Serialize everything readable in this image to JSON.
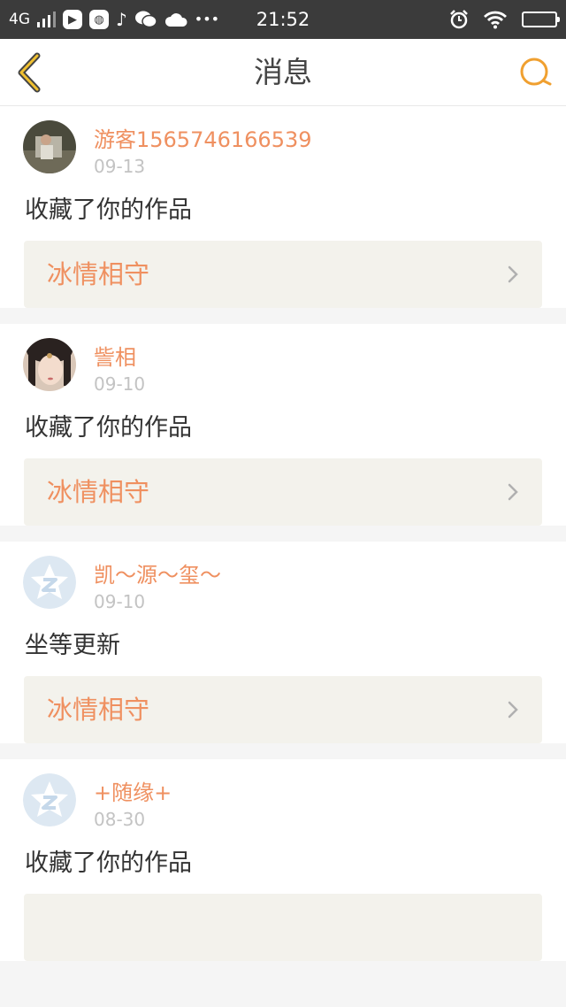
{
  "status_bar": {
    "network": "4G",
    "time": "21:52",
    "icons": [
      "signal-icon",
      "media-app-icon",
      "globe-app-icon",
      "music-app-icon",
      "wechat-icon",
      "cloud-icon",
      "more-dots-icon",
      "alarm-icon",
      "wifi-icon",
      "battery-icon"
    ],
    "overflow": "•••"
  },
  "nav": {
    "title": "消息",
    "back_icon": "chevron-left-icon",
    "search_icon": "search-icon",
    "accent_color": "#f0a030"
  },
  "colors": {
    "name": "#ef9060",
    "date": "#c3c3c3",
    "card_link_bg": "#f3f2ec",
    "divider": "#f5f5f5"
  },
  "messages": [
    {
      "avatar": "photo-avatar",
      "name": "游客1565746166539",
      "date": "09-13",
      "text": "收藏了你的作品",
      "work_title": "冰情相守"
    },
    {
      "avatar": "photo-avatar",
      "name": "訾相",
      "date": "09-10",
      "text": "收藏了你的作品",
      "work_title": "冰情相守"
    },
    {
      "avatar": "default-qq-avatar",
      "name": "凯～源～玺～",
      "date": "09-10",
      "text": "坐等更新",
      "work_title": "冰情相守"
    },
    {
      "avatar": "default-qq-avatar",
      "name": "+随缘+",
      "date": "08-30",
      "text": "收藏了你的作品",
      "work_title": ""
    }
  ]
}
